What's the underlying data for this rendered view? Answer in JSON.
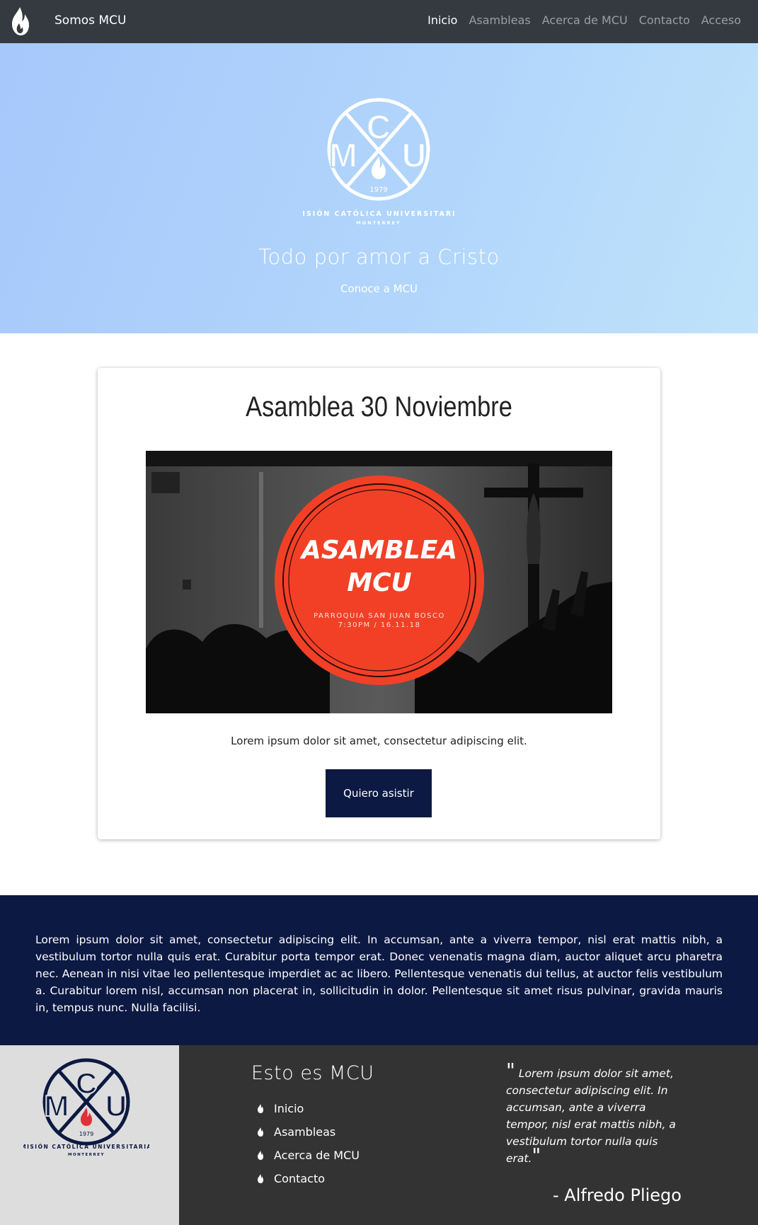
{
  "navbar": {
    "brand": "Somos MCU",
    "links": [
      "Inicio",
      "Asambleas",
      "Acerca de MCU",
      "Contacto",
      "Acceso"
    ],
    "active_index": 0
  },
  "hero": {
    "logo": {
      "icon": "mcu-logo-icon",
      "letters": [
        "C",
        "M",
        "U"
      ],
      "year": "1979",
      "org_name": "MISIÓN CATÓLICA UNIVERSITARIA",
      "city": "MONTERREY"
    },
    "tagline": "Todo por amor a Cristo",
    "link_text": "Conoce a MCU",
    "gradient_colors": [
      "#a6c8fb",
      "#bfe3fa"
    ]
  },
  "event": {
    "title": "Asamblea 30 Noviembre",
    "image": {
      "badge_line1": "ASAMBLEA",
      "badge_line2": "MCU",
      "location": "PARROQUIA SAN JUAN BOSCO",
      "datetime": "7:30PM / 16.11.18",
      "badge_color": "#f24027"
    },
    "description": "Lorem ipsum dolor sit amet, consectetur adipiscing elit.",
    "button_label": "Quiero asistir",
    "button_color": "#0c1942"
  },
  "about": {
    "text": "Lorem ipsum dolor sit amet, consectetur adipiscing elit. In accumsan, ante a viverra tempor, nisl erat mattis nibh, a vestibulum tortor nulla quis erat. Curabitur porta tempor erat. Donec venenatis magna diam, auctor aliquet arcu pharetra nec. Aenean in nisi vitae leo pellentesque imperdiet ac ac libero. Pellentesque venenatis dui tellus, at auctor felis vestibulum a. Curabitur lorem nisl, accumsan non placerat in, sollicitudin in dolor. Pellentesque sit amet risus pulvinar, gravida mauris in, tempus nunc. Nulla facilisi."
  },
  "footer": {
    "logo": {
      "letters": [
        "C",
        "M",
        "U"
      ],
      "year": "1979",
      "org_name": "MISIÓN CATÓLICA UNIVERSITARIA",
      "city": "MONTERREY"
    },
    "heading": "Esto es MCU",
    "links": [
      "Inicio",
      "Asambleas",
      "Acerca de MCU",
      "Contacto"
    ],
    "link_icon": "flame-icon",
    "quote": "Lorem ipsum dolor sit amet, consectetur adipiscing elit. In accumsan, ante a viverra tempor, nisl erat mattis nibh, a vestibulum tortor nulla quis erat.",
    "quote_author": "- Alfredo Pliego"
  }
}
